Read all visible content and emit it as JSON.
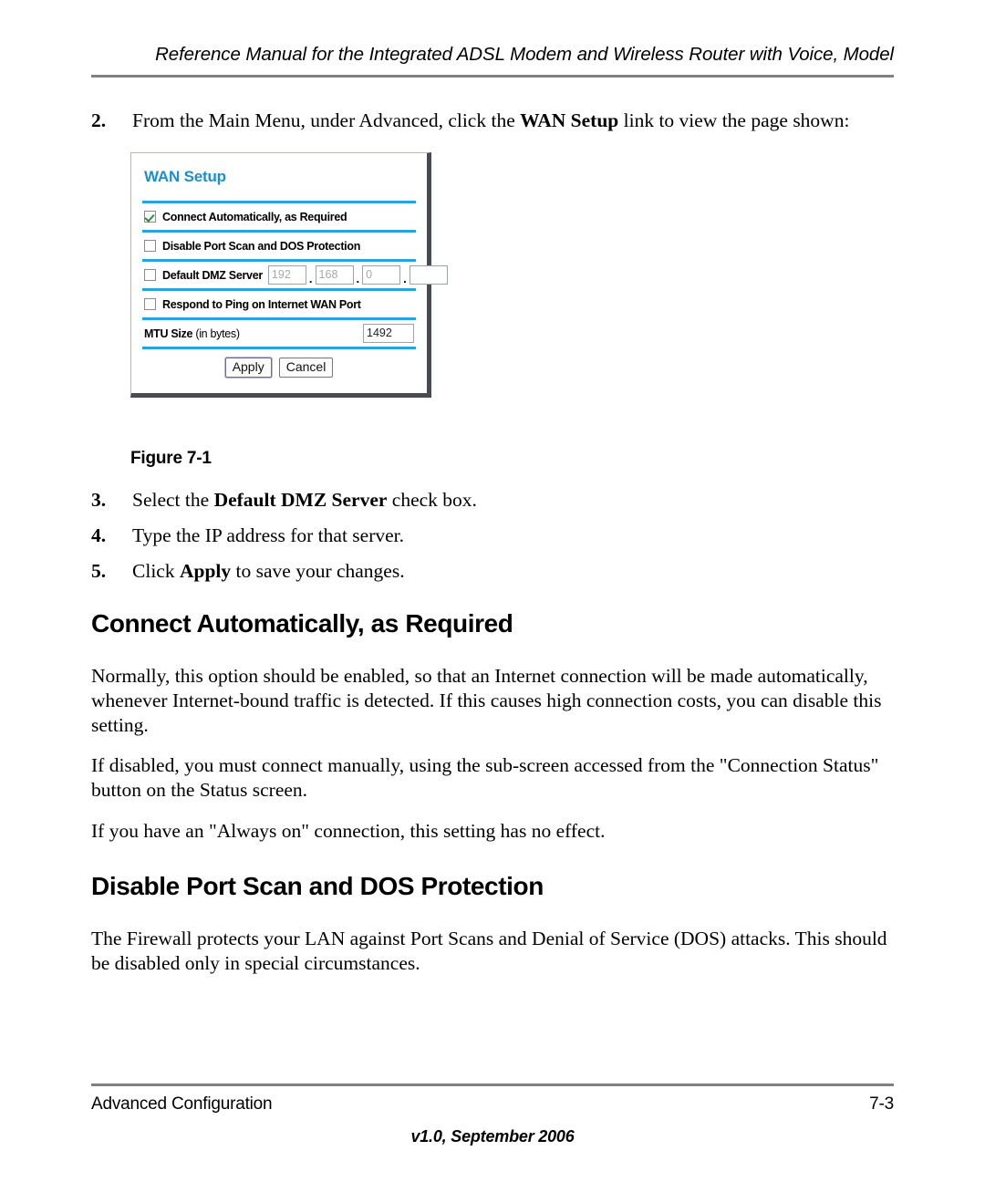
{
  "header": {
    "running_title": "Reference Manual for the Integrated ADSL Modem and Wireless Router with Voice, Model"
  },
  "steps": [
    {
      "number": "2.",
      "text_before": "From the Main Menu, under Advanced, click the ",
      "bold": "WAN Setup",
      "text_after": " link to view the page shown:"
    },
    {
      "number": "3.",
      "text_before": "Select the ",
      "bold": "Default DMZ Server",
      "text_after": " check box."
    },
    {
      "number": "4.",
      "text_before": "Type the IP address for that server.",
      "bold": "",
      "text_after": ""
    },
    {
      "number": "5.",
      "text_before": "Click ",
      "bold": "Apply",
      "text_after": " to save your changes."
    }
  ],
  "figure": {
    "caption": "Figure 7-1",
    "dialog": {
      "title": "WAN Setup",
      "title_color": "#1a8fd0",
      "divider_color": "#27a3e0",
      "rows": {
        "connect_auto": {
          "label": "Connect Automatically, as Required",
          "checked": true
        },
        "disable_port_scan": {
          "label": "Disable Port Scan and DOS Protection",
          "checked": false
        },
        "default_dmz": {
          "label": "Default DMZ Server",
          "checked": false,
          "octets": [
            "192",
            "168",
            "0",
            ""
          ],
          "separator": "."
        },
        "respond_ping": {
          "label": "Respond to Ping on Internet WAN Port",
          "checked": false
        },
        "mtu": {
          "label_bold": "MTU Size",
          "label_normal": " (in bytes)",
          "value": "1492"
        }
      },
      "buttons": {
        "apply": "Apply",
        "cancel": "Cancel"
      }
    }
  },
  "sections": [
    {
      "heading": "Connect Automatically, as Required",
      "paragraphs": [
        "Normally, this option should be enabled, so that an Internet connection will be made automatically, whenever Internet-bound traffic is detected. If this causes high connection costs, you can disable this setting.",
        "If disabled, you must connect manually, using the sub-screen accessed from the \"Connection Status\" button on the Status screen.",
        "If you have an \"Always on\" connection, this setting has no effect."
      ]
    },
    {
      "heading": "Disable Port Scan and DOS Protection",
      "paragraphs": [
        "The Firewall protects your LAN against Port Scans and Denial of Service (DOS) attacks. This should be disabled only in special circumstances."
      ]
    }
  ],
  "footer": {
    "left": "Advanced Configuration",
    "page_number": "7-3",
    "version": "v1.0, September 2006"
  }
}
